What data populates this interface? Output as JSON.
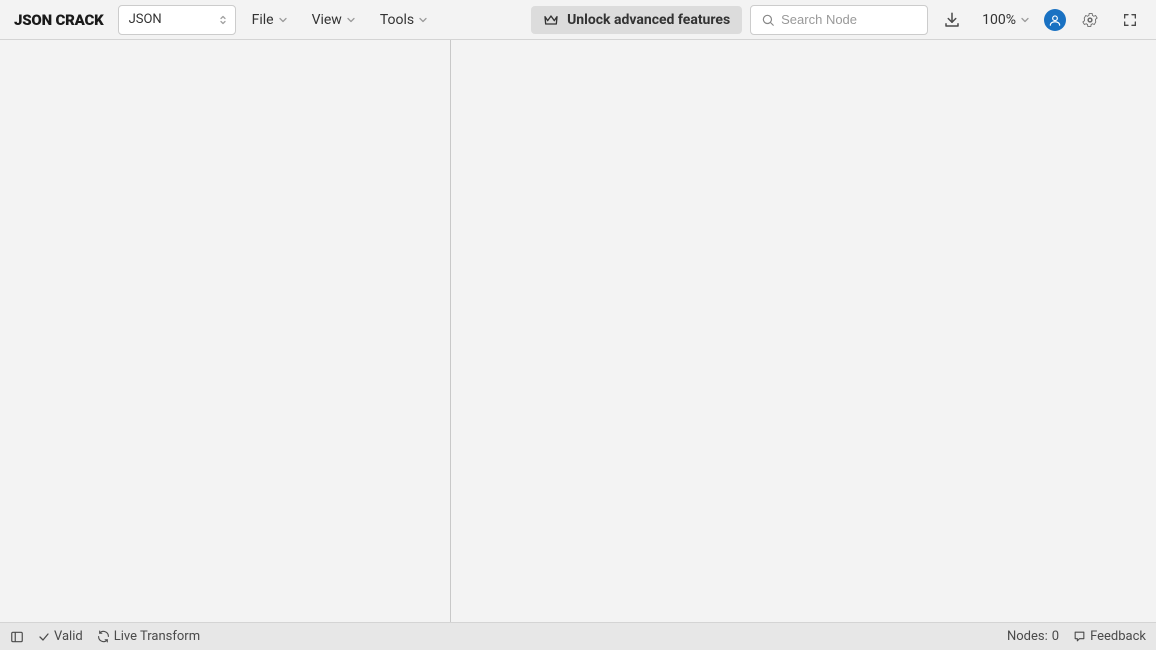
{
  "logo": "JSON CRACK",
  "formatSelect": {
    "value": "JSON"
  },
  "menus": {
    "file": "File",
    "view": "View",
    "tools": "Tools"
  },
  "unlock": {
    "label": "Unlock advanced features"
  },
  "search": {
    "placeholder": "Search Node"
  },
  "zoom": {
    "value": "100%"
  },
  "status": {
    "valid": "Valid",
    "liveTransform": "Live Transform",
    "nodesLabel": "Nodes:",
    "nodesCount": "0",
    "feedback": "Feedback"
  }
}
